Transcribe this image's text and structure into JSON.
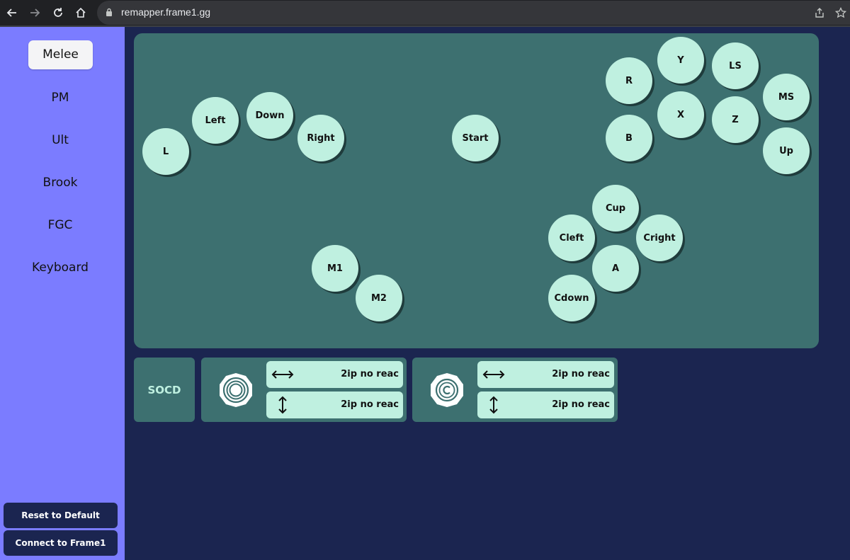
{
  "browser": {
    "url": "remapper.frame1.gg"
  },
  "sidebar": {
    "games": [
      {
        "label": "Melee",
        "active": true
      },
      {
        "label": "PM",
        "active": false
      },
      {
        "label": "Ult",
        "active": false
      },
      {
        "label": "Brook",
        "active": false
      },
      {
        "label": "FGC",
        "active": false
      },
      {
        "label": "Keyboard",
        "active": false
      }
    ],
    "reset_label": "Reset to Default",
    "connect_label": "Connect to Frame1"
  },
  "controller": {
    "buttons": [
      {
        "id": "L",
        "label": "L"
      },
      {
        "id": "Left",
        "label": "Left"
      },
      {
        "id": "Down",
        "label": "Down"
      },
      {
        "id": "Right",
        "label": "Right"
      },
      {
        "id": "Start",
        "label": "Start"
      },
      {
        "id": "R",
        "label": "R"
      },
      {
        "id": "Y",
        "label": "Y"
      },
      {
        "id": "LS",
        "label": "LS"
      },
      {
        "id": "MS",
        "label": "MS"
      },
      {
        "id": "B",
        "label": "B"
      },
      {
        "id": "X",
        "label": "X"
      },
      {
        "id": "Z",
        "label": "Z"
      },
      {
        "id": "Up",
        "label": "Up"
      },
      {
        "id": "Cup",
        "label": "Cup"
      },
      {
        "id": "Cleft",
        "label": "Cleft"
      },
      {
        "id": "Cright",
        "label": "Cright"
      },
      {
        "id": "A",
        "label": "A"
      },
      {
        "id": "Cdown",
        "label": "Cdown"
      },
      {
        "id": "M1",
        "label": "M1"
      },
      {
        "id": "M2",
        "label": "M2"
      }
    ]
  },
  "socd": {
    "label": "SOCD",
    "main_stick": {
      "icon": "analog-stick-icon",
      "horizontal": "2ip no reac",
      "vertical": "2ip no reac"
    },
    "c_stick": {
      "icon": "c-stick-icon",
      "horizontal": "2ip no reac",
      "vertical": "2ip no reac"
    }
  },
  "colors": {
    "sidebar": "#7b7cff",
    "background": "#1b2550",
    "panel": "#3d7070",
    "button": "#bff0e0"
  }
}
